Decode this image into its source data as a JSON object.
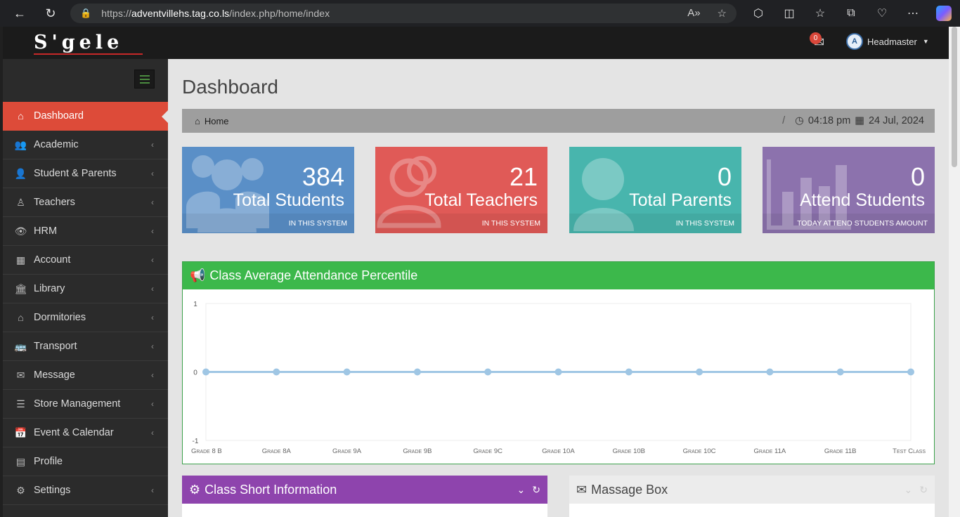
{
  "browser": {
    "url_prefix": "https://",
    "url_host": "adventvillehs.tag.co.ls",
    "url_path": "/index.php/home/index"
  },
  "topbar": {
    "logo": "S'gele",
    "mail_count": "0",
    "user_name": "Headmaster"
  },
  "sidebar": {
    "items": [
      {
        "label": "Dashboard",
        "icon": "home-icon",
        "glyph": "⌂",
        "active": true
      },
      {
        "label": "Academic",
        "icon": "users-icon",
        "glyph": "👥"
      },
      {
        "label": "Student & Parents",
        "icon": "user-icon",
        "glyph": "👤"
      },
      {
        "label": "Teachers",
        "icon": "teacher-icon",
        "glyph": "♙"
      },
      {
        "label": "HRM",
        "icon": "eye-icon",
        "glyph": "👁"
      },
      {
        "label": "Account",
        "icon": "calculator-icon",
        "glyph": "▦"
      },
      {
        "label": "Library",
        "icon": "bank-icon",
        "glyph": "🏛"
      },
      {
        "label": "Dormitories",
        "icon": "house-icon",
        "glyph": "⌂"
      },
      {
        "label": "Transport",
        "icon": "bus-icon",
        "glyph": "🚌"
      },
      {
        "label": "Message",
        "icon": "envelope-icon",
        "glyph": "✉"
      },
      {
        "label": "Store Management",
        "icon": "list-icon",
        "glyph": "☰"
      },
      {
        "label": "Event & Calendar",
        "icon": "calendar-icon",
        "glyph": "📅"
      },
      {
        "label": "Profile",
        "icon": "profile-card-icon",
        "glyph": "▤"
      },
      {
        "label": "Settings",
        "icon": "cogs-icon",
        "glyph": "⚙"
      }
    ]
  },
  "main": {
    "title": "Dashboard",
    "breadcrumb_home": "Home",
    "time": "04:18 pm",
    "date": "24 Jul, 2024",
    "stats": [
      {
        "value": "384",
        "label": "Total Students",
        "foot": "IN THIS SYSTEM",
        "color": "#5a8fc7"
      },
      {
        "value": "21",
        "label": "Total Teachers",
        "foot": "IN THIS SYSTEM",
        "color": "#e05a57"
      },
      {
        "value": "0",
        "label": "Total Parents",
        "foot": "IN THIS SYSTEM",
        "color": "#48b5ad"
      },
      {
        "value": "0",
        "label": "Attend Students",
        "foot": "TODAY ATTEND STUDENTS AMOUNT",
        "color": "#8c72ad"
      }
    ],
    "attendance_panel_title": "Class Average Attendance Percentile",
    "class_panel_title": "Class Short Information",
    "message_panel_title": "Massage Box"
  },
  "chart_data": {
    "type": "line",
    "title": "Class Average Attendance Percentile",
    "categories": [
      "Grade 8 B",
      "Grade 8A",
      "Grade 9A",
      "Grade 9B",
      "Grade 9C",
      "Grade 10A",
      "Grade 10B",
      "Grade 10C",
      "Grade 11A",
      "Grade 11B",
      "Test Class"
    ],
    "series": [
      {
        "values": [
          0,
          0,
          0,
          0,
          0,
          0,
          0,
          0,
          0,
          0,
          0
        ]
      }
    ],
    "y_ticks": [
      "1",
      "0",
      "-1"
    ],
    "ylim": [
      -1,
      1
    ],
    "line_color": "#9fc6e4"
  }
}
